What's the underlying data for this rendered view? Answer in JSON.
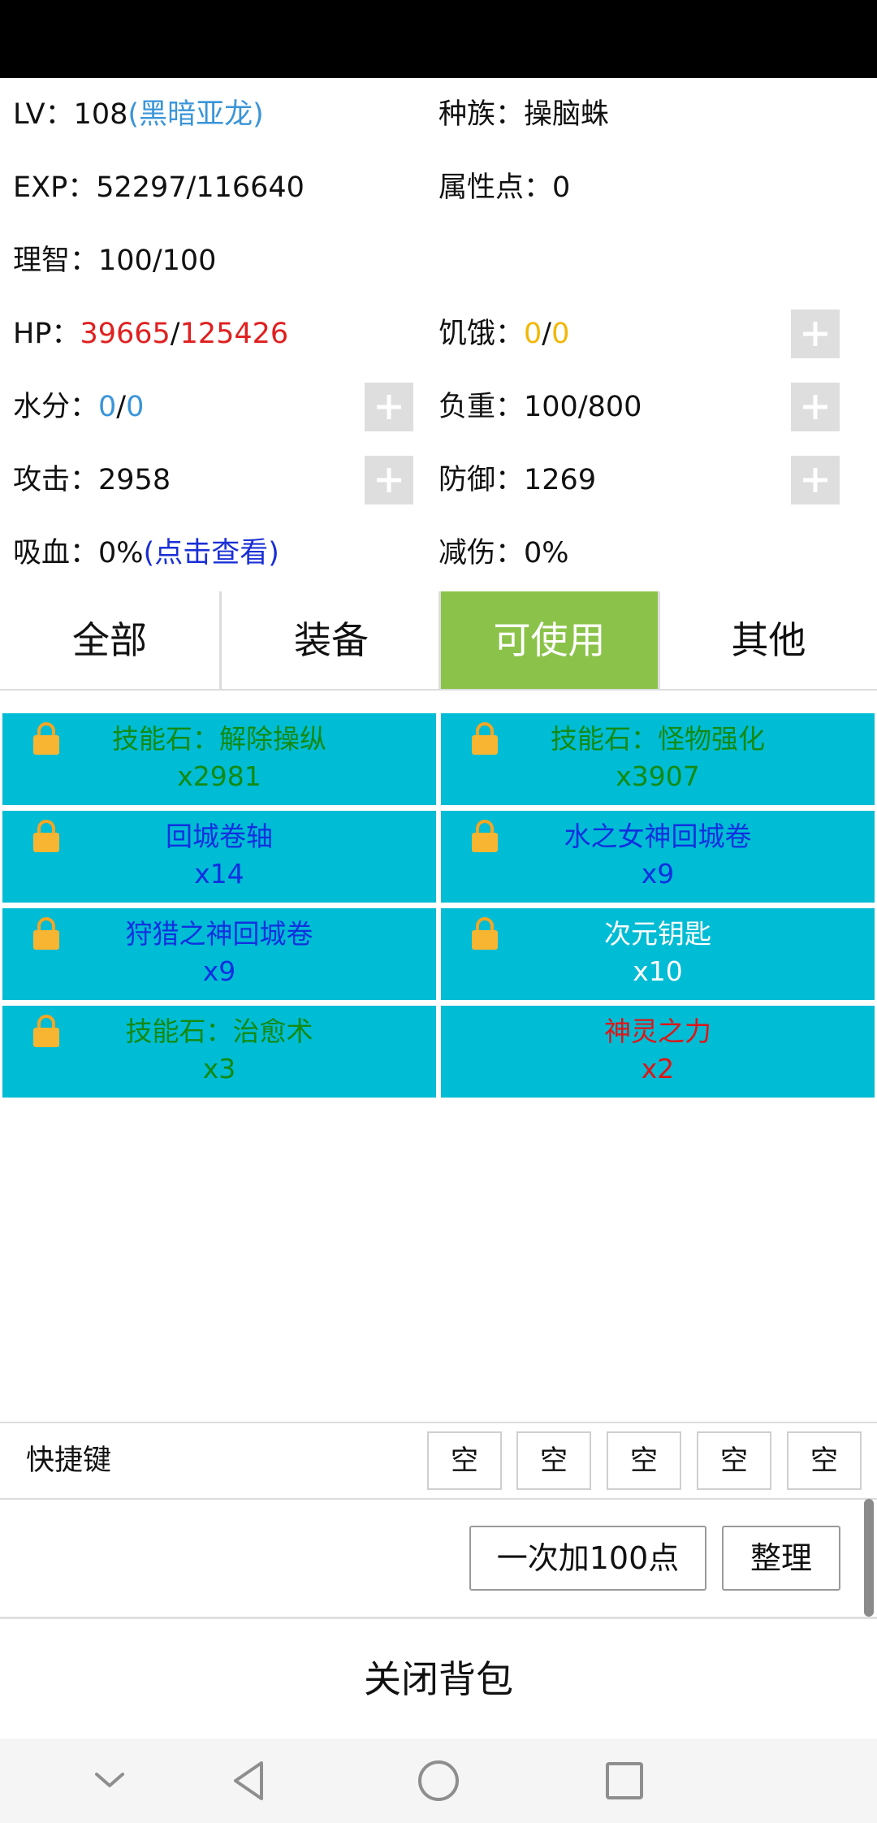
{
  "stats": {
    "level_label": "LV：",
    "level_value": "108",
    "level_title": "(黑暗亚龙)",
    "race_label": "种族：",
    "race_value": "操脑蛛",
    "exp_label": "EXP：",
    "exp_value": "52297/116640",
    "attr_points_label": "属性点：",
    "attr_points_value": "0",
    "sanity_label": "理智：",
    "sanity_value": "100/100",
    "hp_label": "HP：",
    "hp_current": "39665",
    "hp_sep": "/",
    "hp_max": "125426",
    "hunger_label": "饥饿：",
    "hunger_current": "0",
    "hunger_sep": "/",
    "hunger_max": "0",
    "water_label": "水分：",
    "water_current": "0",
    "water_sep": "/",
    "water_max": "0",
    "weight_label": "负重：",
    "weight_value": "100/800",
    "attack_label": "攻击：",
    "attack_value": "2958",
    "defense_label": "防御：",
    "defense_value": "1269",
    "lifesteal_label": "吸血：",
    "lifesteal_value": "0%",
    "lifesteal_link": "(点击查看)",
    "dmg_reduction_label": "减伤：",
    "dmg_reduction_value": "0%"
  },
  "tabs": [
    {
      "label": "全部",
      "active": false
    },
    {
      "label": "装备",
      "active": false
    },
    {
      "label": "可使用",
      "active": true
    },
    {
      "label": "其他",
      "active": false
    }
  ],
  "items": [
    {
      "name": "技能石：解除操纵",
      "qty": "x2981",
      "color": "#138a13",
      "locked": true
    },
    {
      "name": "技能石：怪物强化",
      "qty": "x3907",
      "color": "#138a13",
      "locked": true
    },
    {
      "name": "回城卷轴",
      "qty": "x14",
      "color": "#1030e0",
      "locked": true
    },
    {
      "name": "水之女神回城卷",
      "qty": "x9",
      "color": "#1030e0",
      "locked": true
    },
    {
      "name": "狩猎之神回城卷",
      "qty": "x9",
      "color": "#1030e0",
      "locked": true
    },
    {
      "name": "次元钥匙",
      "qty": "x10",
      "color": "#ffffff",
      "locked": true
    },
    {
      "name": "技能石：治愈术",
      "qty": "x3",
      "color": "#138a13",
      "locked": true
    },
    {
      "name": "神灵之力",
      "qty": "x2",
      "color": "#e01515",
      "locked": false
    }
  ],
  "quickbar": {
    "label": "快捷键",
    "slots": [
      "空",
      "空",
      "空",
      "空",
      "空"
    ]
  },
  "actions": {
    "add100_label": "一次加100点",
    "sort_label": "整理"
  },
  "close_bag_label": "关闭背包",
  "colors": {
    "active_tab": "#8bc34a",
    "item_bg": "#00bcd4",
    "hp_red": "#e02020",
    "link_blue": "#3a95d9",
    "hunger_yellow": "#f2b705"
  },
  "icons": {
    "lock": "lock-icon",
    "plus": "plus-icon",
    "nav_down": "chevron-down-icon",
    "nav_back": "back-triangle-icon",
    "nav_home": "home-circle-icon",
    "nav_recent": "recent-square-icon"
  }
}
